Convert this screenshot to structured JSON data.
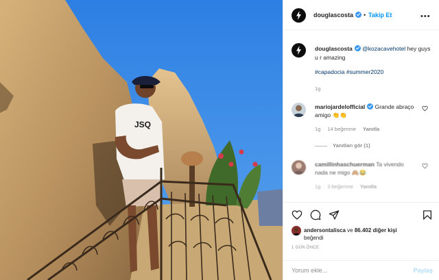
{
  "post": {
    "author": "douglascosta",
    "follow_label": "Takip Et",
    "separator": "•",
    "more_label": "•••",
    "caption": {
      "username": "douglascosta",
      "mention": "@kozacavehotel",
      "text": " hey guys u r amazing",
      "hashtags": "#capadocia #summer2020",
      "age": "1g"
    },
    "comments": [
      {
        "username": "mariojardelofficial",
        "text": " Grande abraço amigo 👏👏",
        "age": "1g",
        "likes": "14 beğenme",
        "reply_label": "Yanıtla",
        "view_replies": "Yanıtları gör (1)"
      },
      {
        "username": "camillinhaschuerman",
        "text": " Ta vivendo nada ne migo 🙈😂",
        "age": "1g",
        "likes": "3 beğenme",
        "reply_label": "Yanıtla"
      }
    ],
    "likes": {
      "user": "andersontalisca",
      "connector": " ve ",
      "count": "86.402 diğer kişi",
      "suffix": "beğendi"
    },
    "posted_ago": "1 GÜN ÖNCE",
    "add_comment_placeholder": "Yorum ekle...",
    "share_label": "Paylaş"
  },
  "icons": {
    "like": "heart-icon",
    "comment": "comment-icon",
    "share": "paper-plane-icon",
    "save": "bookmark-icon",
    "verified": "verified-badge-icon",
    "comment_like": "small-heart-icon"
  },
  "colors": {
    "accent": "#0095f6",
    "verified": "#3897f0",
    "sky": "#3a88e6",
    "rock": "#c7a06a"
  }
}
